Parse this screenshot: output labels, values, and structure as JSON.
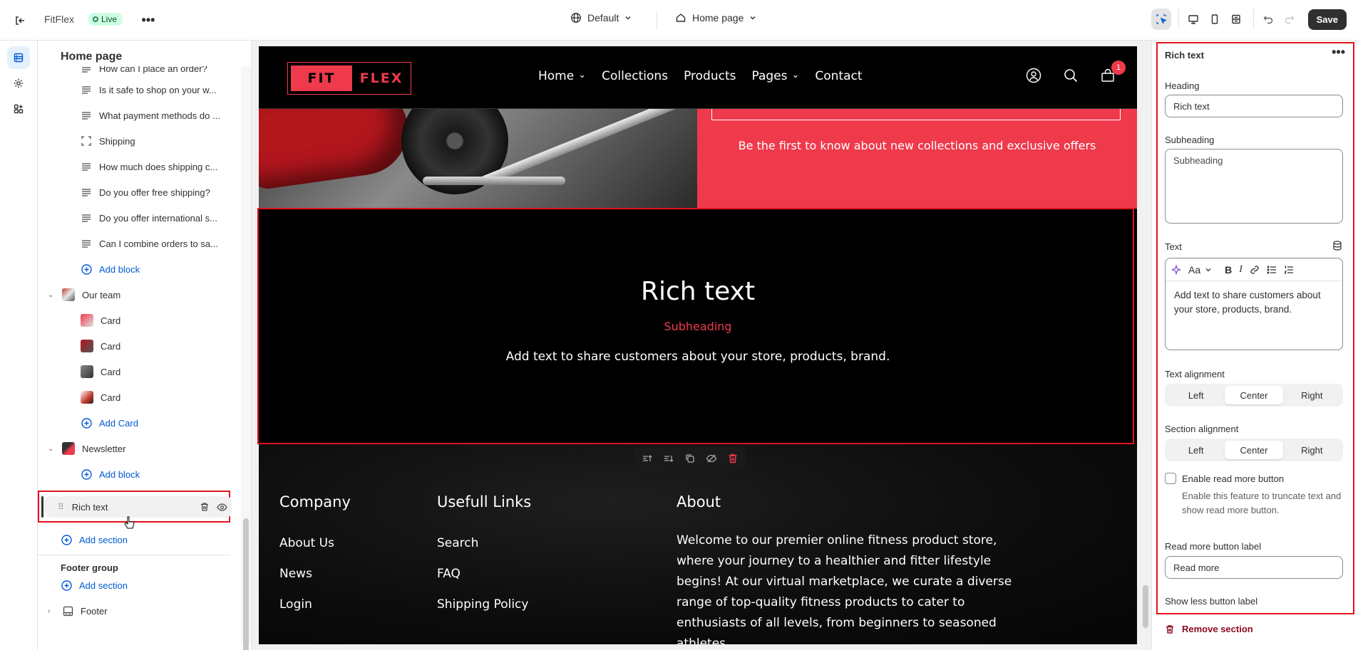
{
  "topbar": {
    "store_name": "FitFlex",
    "live_label": "Live",
    "theme_label": "Default",
    "page_label": "Home page",
    "save_label": "Save"
  },
  "left_panel": {
    "title": "Home page",
    "blocks": [
      {
        "label": "How can I place an order?",
        "icon": "text-lines-icon"
      },
      {
        "label": "Is it safe to shop on your w...",
        "icon": "text-lines-icon"
      },
      {
        "label": "What payment methods do ...",
        "icon": "text-lines-icon"
      },
      {
        "label": "Shipping",
        "icon": "frame-icon"
      },
      {
        "label": "How much does shipping c...",
        "icon": "text-lines-icon"
      },
      {
        "label": "Do you offer free shipping?",
        "icon": "text-lines-icon"
      },
      {
        "label": "Do you offer international s...",
        "icon": "text-lines-icon"
      },
      {
        "label": "Can I combine orders to sa...",
        "icon": "text-lines-icon"
      }
    ],
    "add_block_label": "Add block",
    "team_section": "Our team",
    "team_cards": [
      "Card",
      "Card",
      "Card",
      "Card"
    ],
    "add_card_label": "Add Card",
    "newsletter_section": "Newsletter",
    "add_block_label_2": "Add block",
    "selected_section": "Rich text",
    "add_section_label": "Add section",
    "footer_group_label": "Footer group",
    "add_section_label_2": "Add section",
    "footer_section": "Footer"
  },
  "site": {
    "logo_left": "FIT",
    "logo_right": "FLEX",
    "nav": [
      {
        "label": "Home",
        "dropdown": true
      },
      {
        "label": "Collections",
        "dropdown": false
      },
      {
        "label": "Products",
        "dropdown": false
      },
      {
        "label": "Pages",
        "dropdown": true
      },
      {
        "label": "Contact",
        "dropdown": false
      }
    ],
    "cart_count": "1",
    "banner_text": "Be the first to know about new collections and exclusive offers",
    "rich_heading": "Rich text",
    "rich_subheading": "Subheading",
    "rich_text": "Add text to share customers about your store, products, brand.",
    "footer": {
      "col1_title": "Company",
      "col1_links": [
        "About Us",
        "News",
        "Login"
      ],
      "col2_title": "Usefull Links",
      "col2_links": [
        "Search",
        "FAQ",
        "Shipping Policy"
      ],
      "col3_title": "About",
      "col3_text": "Welcome to our premier online fitness product store, where your journey to a healthier and fitter lifestyle begins! At our virtual marketplace, we curate a diverse range of top-quality fitness products to cater to enthusiasts of all levels, from beginners to seasoned athletes."
    },
    "colors": {
      "accent": "#ef3a4c",
      "background": "#000000"
    }
  },
  "right_panel": {
    "title": "Rich text",
    "heading_label": "Heading",
    "heading_value": "Rich text",
    "subheading_label": "Subheading",
    "subheading_value": "Subheading",
    "text_label": "Text",
    "text_value": "Add text to share customers about your store, products, brand.",
    "text_alignment_label": "Text alignment",
    "section_alignment_label": "Section alignment",
    "alignment_options": [
      "Left",
      "Center",
      "Right"
    ],
    "text_alignment_selected": "Center",
    "section_alignment_selected": "Center",
    "read_more_checkbox_label": "Enable read more button",
    "read_more_help": "Enable this feature to truncate text and show read more button.",
    "read_more_checked": false,
    "read_more_label_label": "Read more button label",
    "read_more_label_value": "Read more",
    "show_less_label": "Show less button label",
    "remove_section_label": "Remove section",
    "font_button_label": "Aa"
  }
}
